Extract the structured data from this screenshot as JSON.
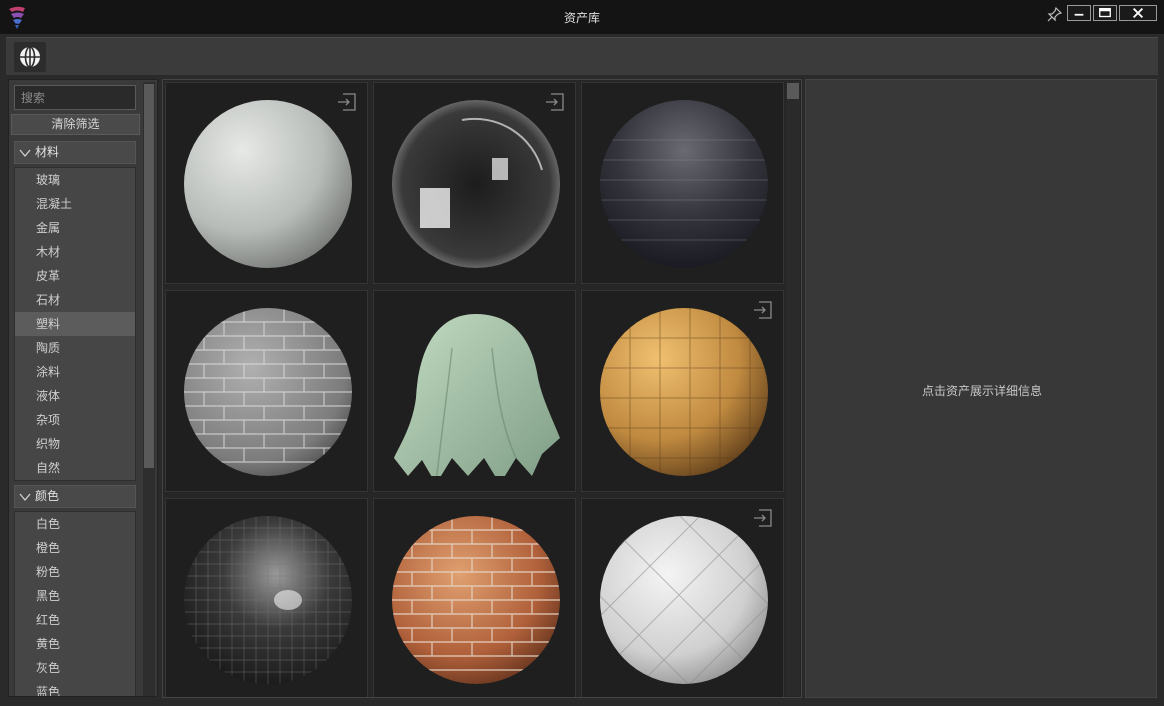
{
  "window": {
    "title": "资产库"
  },
  "sidebar": {
    "search": {
      "placeholder": "搜索",
      "value": ""
    },
    "clear_label": "清除筛选",
    "groups": [
      {
        "label": "材料",
        "items": [
          "玻璃",
          "混凝土",
          "金属",
          "木材",
          "皮革",
          "石材",
          "塑料",
          "陶质",
          "涂料",
          "液体",
          "杂项",
          "织物",
          "自然"
        ],
        "selected": "塑料"
      },
      {
        "label": "颜色",
        "items": [
          "白色",
          "橙色",
          "粉色",
          "黑色",
          "红色",
          "黄色",
          "灰色",
          "蓝色"
        ]
      }
    ]
  },
  "detail": {
    "hint": "点击资产展示详细信息"
  },
  "colors": {
    "accent_logo": "#c04070",
    "selected_item": "#5c5c5c"
  },
  "icons": {
    "logo": "app-logo-icon",
    "pin": "pin-icon",
    "globe": "globe-icon",
    "import": "import-icon",
    "chevron": "chevron-down-icon"
  }
}
